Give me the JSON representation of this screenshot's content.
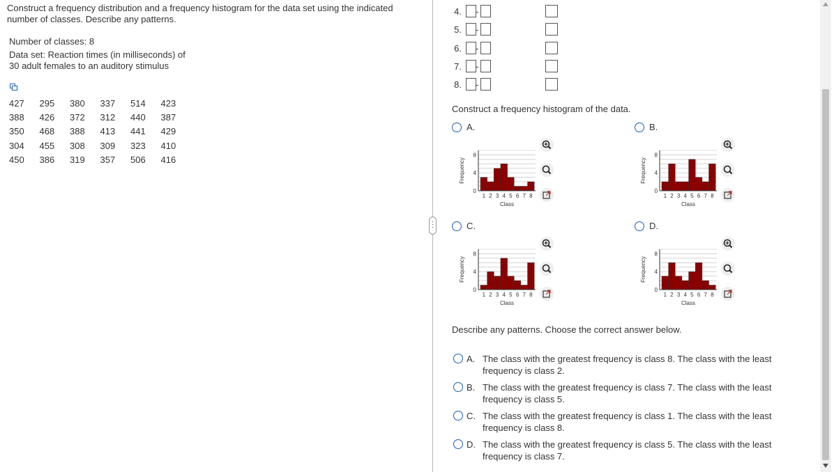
{
  "question": {
    "text": "Construct a frequency distribution and a frequency histogram for the data set using the indicated number of classes. Describe any patterns.",
    "num_classes_label": "Number of classes: 8",
    "data_set_line1": "Data set: Reaction times (in milliseconds) of",
    "data_set_line2": "30 adult females to an auditory stimulus"
  },
  "data_rows": [
    [
      "427",
      "295",
      "380",
      "337",
      "514",
      "423"
    ],
    [
      "388",
      "426",
      "372",
      "312",
      "440",
      "387"
    ],
    [
      "350",
      "468",
      "388",
      "413",
      "441",
      "429"
    ],
    [
      "304",
      "455",
      "308",
      "309",
      "323",
      "410"
    ],
    [
      "450",
      "386",
      "319",
      "357",
      "506",
      "416"
    ]
  ],
  "class_rows": [
    {
      "num": "4.",
      "sep": "-"
    },
    {
      "num": "5.",
      "sep": "-"
    },
    {
      "num": "6.",
      "sep": "-"
    },
    {
      "num": "7.",
      "sep": "-"
    },
    {
      "num": "8.",
      "sep": "-"
    }
  ],
  "histogram_prompt": "Construct a frequency histogram of the data.",
  "histogram_options": [
    {
      "letter": "A.",
      "bars": [
        3,
        2,
        5,
        6,
        3,
        1,
        1,
        2
      ]
    },
    {
      "letter": "B.",
      "bars": [
        2,
        6,
        2,
        2,
        7,
        3,
        2,
        6
      ]
    },
    {
      "letter": "C.",
      "bars": [
        1,
        4,
        3,
        7,
        3,
        2,
        1,
        6
      ]
    },
    {
      "letter": "D.",
      "bars": [
        3,
        6,
        3,
        2,
        4,
        6,
        2,
        1
      ]
    }
  ],
  "chart_labels": {
    "ylabel": "Frequency",
    "xlabel": "Class",
    "yticks": [
      "0",
      "4",
      "8"
    ],
    "xticks": [
      "1",
      "2",
      "3",
      "4",
      "5",
      "6",
      "7",
      "8"
    ]
  },
  "patterns_prompt": "Describe any patterns. Choose the correct answer below.",
  "answers": [
    {
      "letter": "A.",
      "text": "The class with the greatest frequency is class 8. The class with the least frequency is class 2."
    },
    {
      "letter": "B.",
      "text": "The class with the greatest frequency is class 7. The class with the least frequency is class 5."
    },
    {
      "letter": "C.",
      "text": "The class with the greatest frequency is class 1. The class with the least frequency is class 8."
    },
    {
      "letter": "D.",
      "text": "The class with the greatest frequency is class 5. The class with the least frequency is class 7."
    }
  ],
  "colors": {
    "bar": "#8b0000",
    "radio": "#1a5fb4"
  }
}
